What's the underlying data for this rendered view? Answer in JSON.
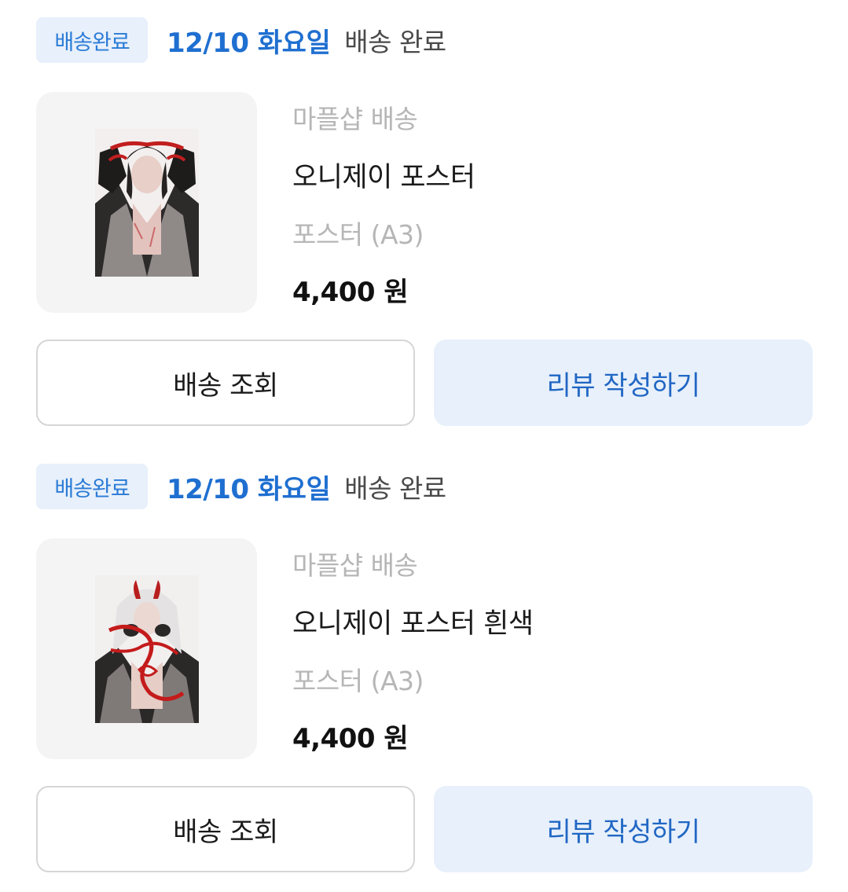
{
  "orders": [
    {
      "status_badge": "배송완료",
      "date": "12/10 화요일",
      "status_text": "배송 완료",
      "seller": "마플샵 배송",
      "product_name": "오니제이 포스터",
      "option": "포스터 (A3)",
      "price": "4,400 원",
      "track_button": "배송 조회",
      "review_button": "리뷰 작성하기"
    },
    {
      "status_badge": "배송완료",
      "date": "12/10 화요일",
      "status_text": "배송 완료",
      "seller": "마플샵 배송",
      "product_name": "오니제이 포스터 흰색",
      "option": "포스터 (A3)",
      "price": "4,400 원",
      "track_button": "배송 조회",
      "review_button": "리뷰 작성하기"
    }
  ],
  "colors": {
    "accent": "#1f6fd0",
    "badge_bg": "#e7f0fb",
    "muted_text": "#b6b6b6"
  }
}
